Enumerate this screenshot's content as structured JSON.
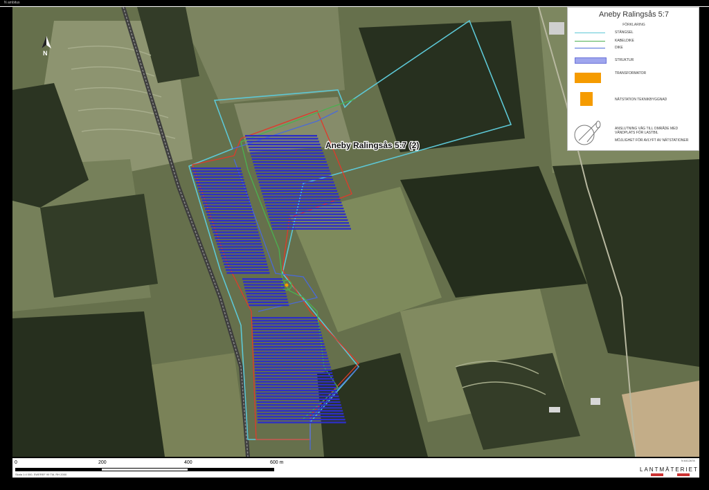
{
  "map": {
    "title": "Aneby Ralingsås 5:7",
    "area_label": "Aneby Ralingsås 5:7 (2)",
    "north_label": "N",
    "top_caption": "N ambitus"
  },
  "legend": {
    "title": "Aneby Ralingsås 5:7",
    "subtitle": "FÖRKLARING",
    "items": [
      {
        "label": "STÄNGSEL",
        "color": "#5dc8d6",
        "kind": "line"
      },
      {
        "label": "KABELDIKE",
        "color": "#4caf50",
        "kind": "line"
      },
      {
        "label": "DIKE",
        "color": "#4a6ad8",
        "kind": "line"
      },
      {
        "label": "STRUKTUR",
        "color": "#9fa6ee",
        "kind": "box"
      },
      {
        "label": "TRANSFORMATOR",
        "color": "#f59b00",
        "kind": "box"
      },
      {
        "label": "NÄTSTATION TEKNIKBYGGNAD",
        "color": "#f59b00",
        "kind": "box"
      },
      {
        "label": "ANSLUTNING VÄG TILL OMRÅDE MED VÄNDPLATS FÖR LASTBIL",
        "kind": "symbol"
      },
      {
        "label": "MÖJLIGHET FÖR AVLYFT AV NÄTSTATIONER",
        "kind": "text"
      }
    ]
  },
  "scale": {
    "ticks": [
      "0",
      "200",
      "400",
      "600 m"
    ],
    "note": "Skala 1:4 000, SWEREF 99 TM, RH 2000"
  },
  "footer": {
    "coordinate": "N 6412678",
    "brand": "LANTMÄTERIET"
  },
  "colors": {
    "fence": "#5dc8d6",
    "cable": "#4caf50",
    "ditch": "#4a6ad8",
    "boundary": "#e0392b",
    "panels": "#2d2fc4"
  }
}
